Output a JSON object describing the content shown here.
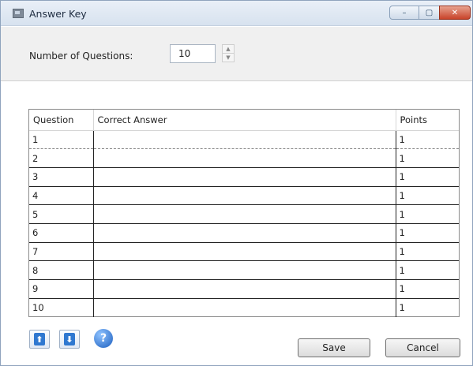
{
  "window": {
    "title": "Answer Key",
    "controls": {
      "minimize": "–",
      "maximize": "▢",
      "close": "✕"
    }
  },
  "settings": {
    "num_questions_label": "Number of Questions:",
    "num_questions_value": "10"
  },
  "table": {
    "headers": [
      "Question",
      "Correct Answer",
      "Points"
    ],
    "rows": [
      {
        "question": "1",
        "answer": "",
        "points": "1"
      },
      {
        "question": "2",
        "answer": "",
        "points": "1"
      },
      {
        "question": "3",
        "answer": "",
        "points": "1"
      },
      {
        "question": "4",
        "answer": "",
        "points": "1"
      },
      {
        "question": "5",
        "answer": "",
        "points": "1"
      },
      {
        "question": "6",
        "answer": "",
        "points": "1"
      },
      {
        "question": "7",
        "answer": "",
        "points": "1"
      },
      {
        "question": "8",
        "answer": "",
        "points": "1"
      },
      {
        "question": "9",
        "answer": "",
        "points": "1"
      },
      {
        "question": "10",
        "answer": "",
        "points": "1"
      }
    ]
  },
  "toolbar": {
    "up_icon": "⬆",
    "down_icon": "⬇",
    "help_icon": "?"
  },
  "buttons": {
    "save": "Save",
    "cancel": "Cancel"
  }
}
